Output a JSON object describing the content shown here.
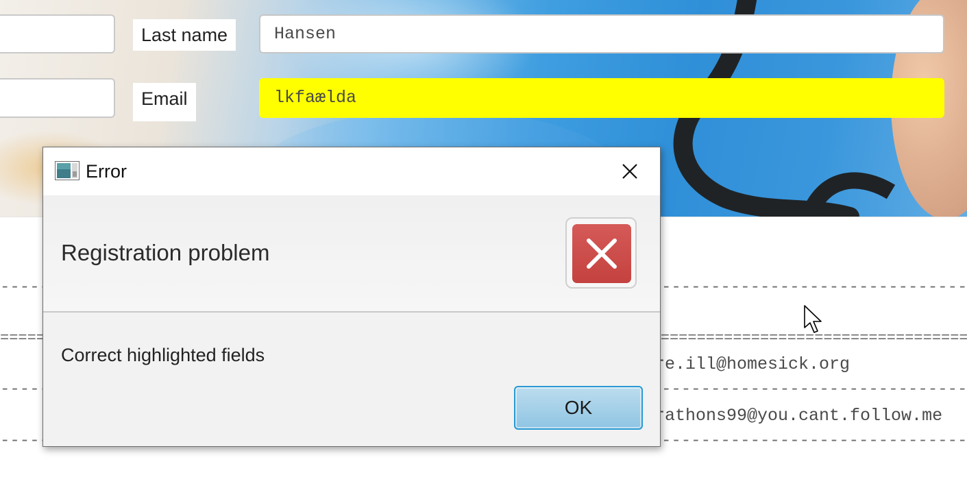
{
  "form": {
    "last_name_label": "Last name",
    "last_name_value": "Hansen",
    "email_label": "Email",
    "email_value": "lkfaælda",
    "email_highlight_color": "#ffff00"
  },
  "table": {
    "dash_line": "----------------------------------------------------------------------------------------------------------------------------",
    "double_line": "============================================================================================================================",
    "rows": [
      {
        "email_partial": "re.ill@homesick.org"
      },
      {
        "email_partial": "rathons99@you.cant.follow.me"
      }
    ]
  },
  "dialog": {
    "title": "Error",
    "header": "Registration problem",
    "content": "Correct highlighted fields",
    "ok_label": "OK",
    "close_icon": "close-icon",
    "status_icon": "error-icon",
    "status_color": "#c94a48",
    "button_accent": "#2a9ad3"
  }
}
